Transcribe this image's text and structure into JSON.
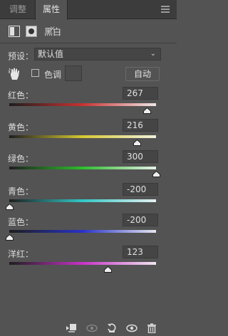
{
  "tabs": [
    {
      "label": "调整"
    },
    {
      "label": "属性"
    }
  ],
  "tab_close_glyph": "×",
  "header": {
    "title": "黑白"
  },
  "preset": {
    "label": "预设：",
    "value": "默认值"
  },
  "tint": {
    "label": "色调",
    "checked": false
  },
  "auto_button": {
    "label": "自动"
  },
  "sliders": [
    {
      "label": "红色：",
      "value": "267",
      "fraction": 0.94,
      "gradient": [
        "#1e1e1e",
        "#c83232",
        "#f0e6e6"
      ]
    },
    {
      "label": "黄色：",
      "value": "216",
      "fraction": 0.87,
      "gradient": [
        "#1e1e1e",
        "#d6c832",
        "#f0f0dc"
      ]
    },
    {
      "label": "绿色：",
      "value": "300",
      "fraction": 1.0,
      "gradient": [
        "#1e1e1e",
        "#2dbe2d",
        "#e6f0e6"
      ]
    },
    {
      "label": "青色：",
      "value": "-200",
      "fraction": 0.0,
      "gradient": [
        "#1e1e1e",
        "#32c8c8",
        "#e6f0f0"
      ]
    },
    {
      "label": "蓝色：",
      "value": "-200",
      "fraction": 0.0,
      "gradient": [
        "#1e1e1e",
        "#2832c8",
        "#e6e6f0"
      ]
    },
    {
      "label": "洋红：",
      "value": "123",
      "fraction": 0.67,
      "gradient": [
        "#1e1e1e",
        "#c832c8",
        "#f0e6f0"
      ]
    }
  ],
  "toolbar_icons": [
    "clip-to-layer-icon",
    "view-previous-state-icon",
    "reset-icon",
    "visibility-icon",
    "delete-icon"
  ],
  "colors": {
    "panel": "#535353",
    "tabbar": "#3c3c3c",
    "field": "#454545"
  }
}
